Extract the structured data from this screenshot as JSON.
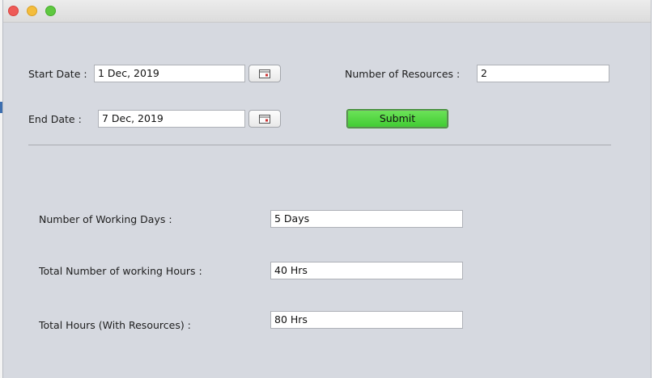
{
  "form": {
    "start_date": {
      "label": "Start Date :",
      "value": "1 Dec, 2019"
    },
    "end_date": {
      "label": "End Date :",
      "value": "7 Dec, 2019"
    },
    "resources": {
      "label": "Number of Resources :",
      "value": "2"
    },
    "submit_label": "Submit"
  },
  "results": {
    "working_days": {
      "label": "Number of Working Days :",
      "value": "5 Days"
    },
    "working_hours": {
      "label": "Total Number of working Hours :",
      "value": "40 Hrs"
    },
    "total_hours": {
      "label": "Total Hours (With Resources) :",
      "value": "80 Hrs"
    }
  },
  "icons": {
    "calendar": "calendar-icon"
  },
  "colors": {
    "submit_green": "#4ed63d",
    "background": "#d6d9e0"
  }
}
